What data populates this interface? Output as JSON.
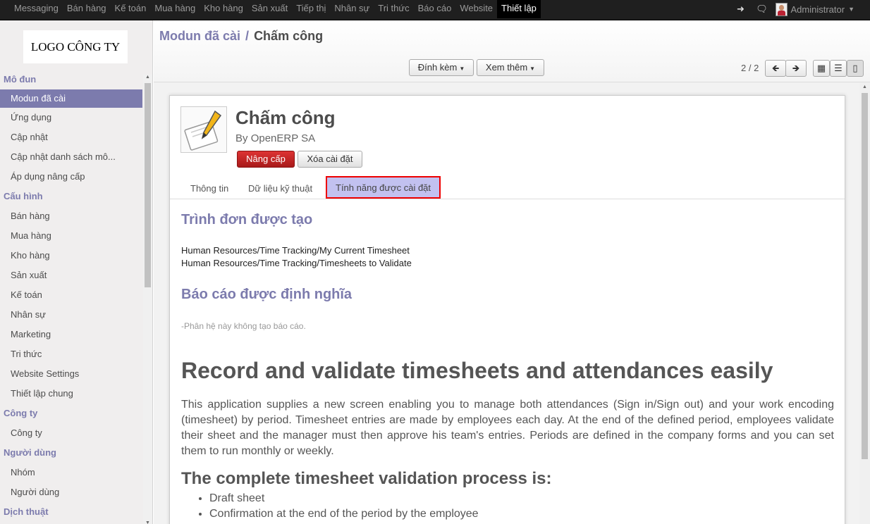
{
  "topbar": {
    "menu": [
      "Messaging",
      "Bán hàng",
      "Kế toán",
      "Mua hàng",
      "Kho hàng",
      "Sản xuất",
      "Tiếp thị",
      "Nhân sự",
      "Tri thức",
      "Báo cáo",
      "Website",
      "Thiết lập"
    ],
    "active_menu": "Thiết lập",
    "user": "Administrator"
  },
  "sidebar": {
    "logo_text": "LOGO CÔNG TY",
    "sections": [
      {
        "title": "Mô đun",
        "items": [
          "Modun đã cài",
          "Ứng dụng",
          "Cập nhật",
          "Cập nhật danh sách mô...",
          "Áp dụng nâng cấp"
        ]
      },
      {
        "title": "Cấu hình",
        "items": [
          "Bán hàng",
          "Mua hàng",
          "Kho hàng",
          "Sản xuất",
          "Kế toán",
          "Nhân sự",
          "Marketing",
          "Tri thức",
          "Website Settings",
          "Thiết lập chung"
        ]
      },
      {
        "title": "Công ty",
        "items": [
          "Công ty"
        ]
      },
      {
        "title": "Người dùng",
        "items": [
          "Nhóm",
          "Người dùng"
        ]
      },
      {
        "title": "Dịch thuật",
        "items": []
      }
    ],
    "active_item": "Modun đã cài"
  },
  "header": {
    "breadcrumb_link": "Modun đã cài",
    "breadcrumb_sep": "/",
    "breadcrumb_current": "Chấm công",
    "attach_label": "Đính kèm",
    "more_label": "Xem thêm",
    "pager": "2 / 2"
  },
  "module": {
    "title": "Chấm công",
    "by_prefix": "By",
    "author": "OpenERP SA",
    "upgrade_label": "Nâng cấp",
    "uninstall_label": "Xóa cài đặt",
    "tabs": [
      "Thông tin",
      "Dữ liệu kỹ thuật",
      "Tính năng được cài đặt"
    ],
    "menus_title": "Trình đơn được tạo",
    "menus": [
      "Human Resources/Time Tracking/My Current Timesheet",
      "Human Resources/Time Tracking/Timesheets to Validate"
    ],
    "reports_title": "Báo cáo được định nghĩa",
    "reports_note": "-Phân hệ này không tạo báo cáo.",
    "desc_h1": "Record and validate timesheets and attendances easily",
    "desc_p": "This application supplies a new screen enabling you to manage both attendances (Sign in/Sign out) and your work encoding (timesheet) by period. Timesheet entries are made by employees each day. At the end of the defined period, employees validate their sheet and the manager must then approve his team's entries. Periods are defined in the company forms and you can set them to run monthly or weekly.",
    "desc_h2": "The complete timesheet validation process is:",
    "desc_list": [
      "Draft sheet",
      "Confirmation at the end of the period by the employee"
    ]
  }
}
